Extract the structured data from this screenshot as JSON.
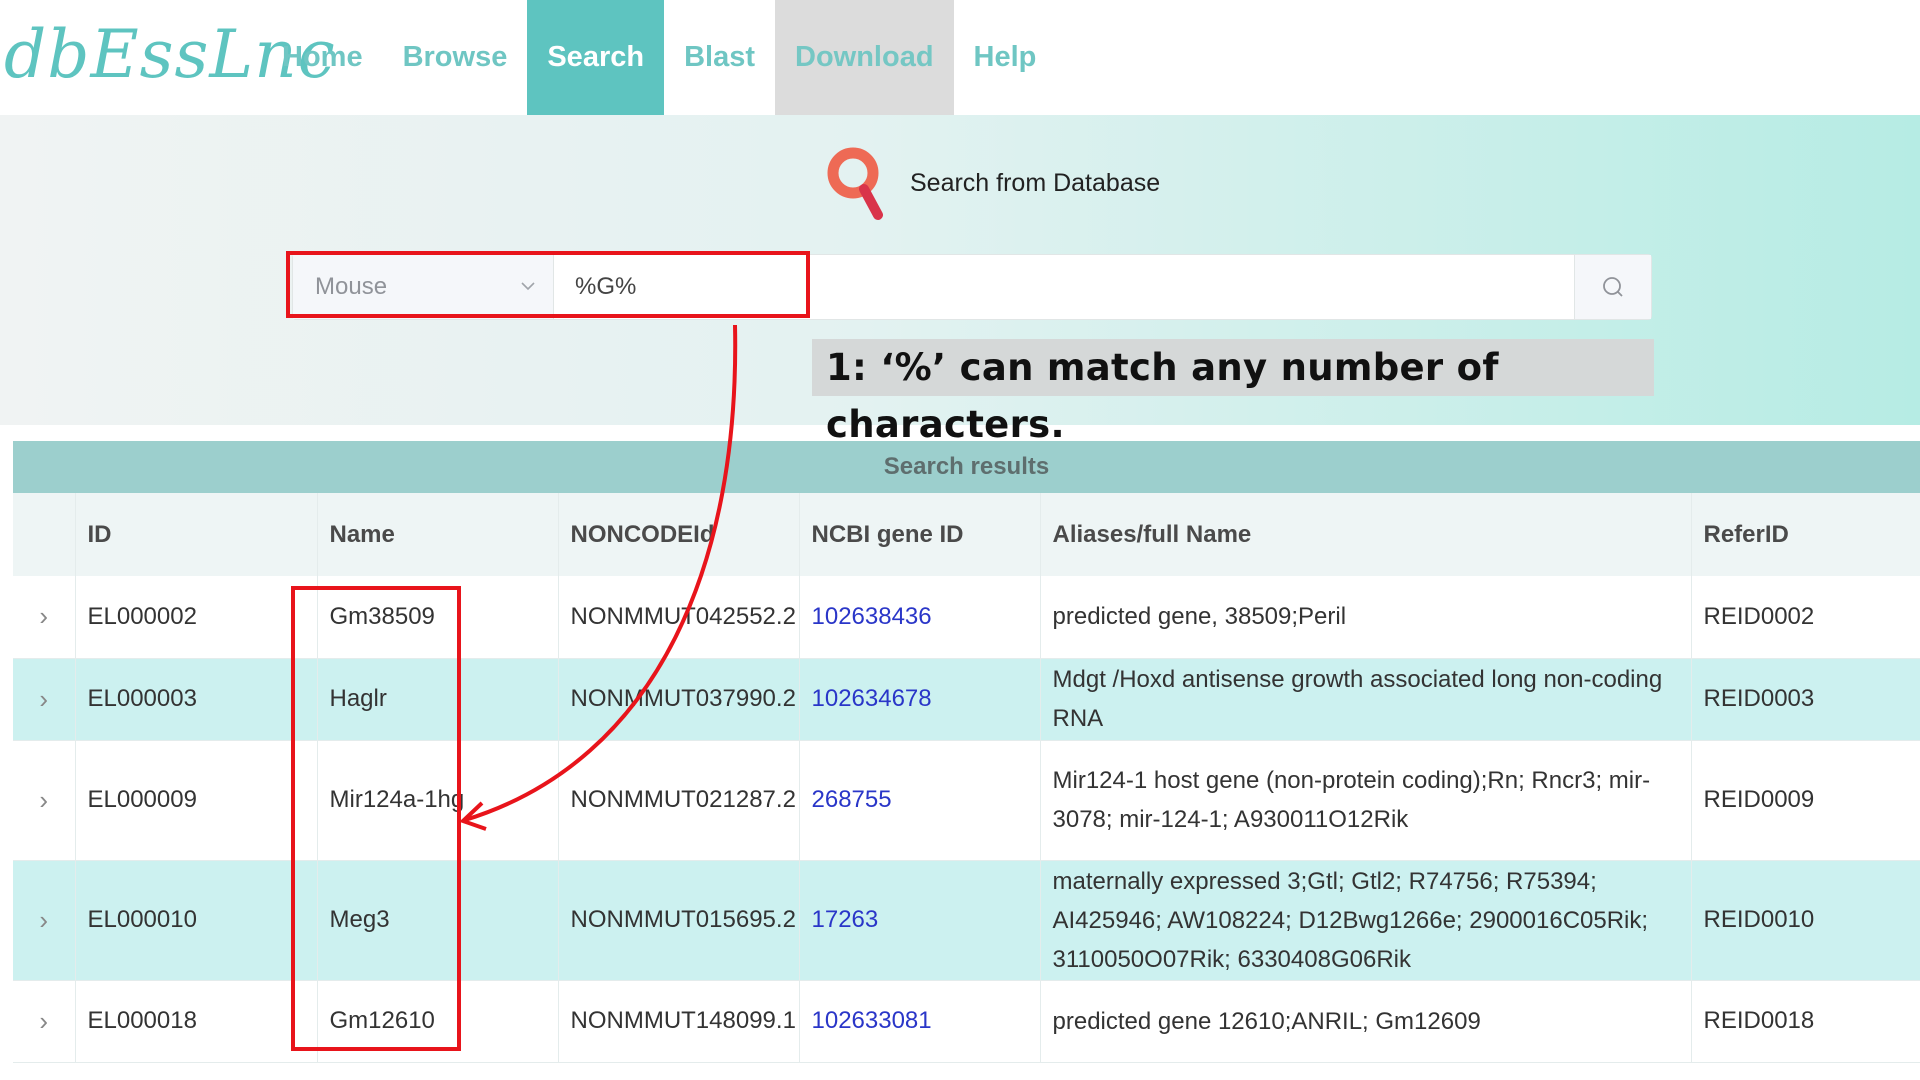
{
  "header": {
    "logo": "dbEssLnc",
    "nav": [
      {
        "label": "Home",
        "state": "normal"
      },
      {
        "label": "Browse",
        "state": "normal"
      },
      {
        "label": "Search",
        "state": "active"
      },
      {
        "label": "Blast",
        "state": "normal"
      },
      {
        "label": "Download",
        "state": "disabled"
      },
      {
        "label": "Help",
        "state": "normal"
      }
    ]
  },
  "search": {
    "title": "Search from Database",
    "species_selected": "Mouse",
    "query": "%G%",
    "icon": "search-icon"
  },
  "annotation": {
    "note": "1: ‘%’ can match any number of characters."
  },
  "results": {
    "caption": "Search results",
    "columns": [
      "ID",
      "Name",
      "NONCODEId",
      "NCBI gene ID",
      "Aliases/full Name",
      "ReferID"
    ],
    "rows": [
      {
        "id": "EL000002",
        "name": "Gm38509",
        "noncode": "NONMMUT042552.2",
        "ncbi": "102638436",
        "aliases": "predicted gene, 38509;Peril",
        "refer": "REID0002"
      },
      {
        "id": "EL000003",
        "name": "Haglr",
        "noncode": "NONMMUT037990.2",
        "ncbi": "102634678",
        "aliases": "Mdgt /Hoxd antisense growth associated long non-coding RNA",
        "refer": "REID0003"
      },
      {
        "id": "EL000009",
        "name": "Mir124a-1hg",
        "noncode": "NONMMUT021287.2",
        "ncbi": "268755",
        "aliases": "Mir124-1 host gene (non-protein coding);Rn; Rncr3; mir-3078; mir-124-1; A930011O12Rik",
        "refer": "REID0009"
      },
      {
        "id": "EL000010",
        "name": "Meg3",
        "noncode": "NONMMUT015695.2",
        "ncbi": "17263",
        "aliases": "maternally expressed 3;Gtl; Gtl2; R74756; R75394; AI425946; AW108224; D12Bwg1266e; 2900016C05Rik; 3110050O07Rik; 6330408G06Rik",
        "refer": "REID0010"
      },
      {
        "id": "EL000018",
        "name": "Gm12610",
        "noncode": "NONMMUT148099.1",
        "ncbi": "102633081",
        "aliases": "predicted gene 12610;ANRIL; Gm12609",
        "refer": "REID0018"
      }
    ]
  },
  "colors": {
    "accent": "#5ec4c0",
    "annotation_red": "#e8141b",
    "link_blue": "#2a36c8",
    "row_highlight": "#ccf1f0"
  }
}
